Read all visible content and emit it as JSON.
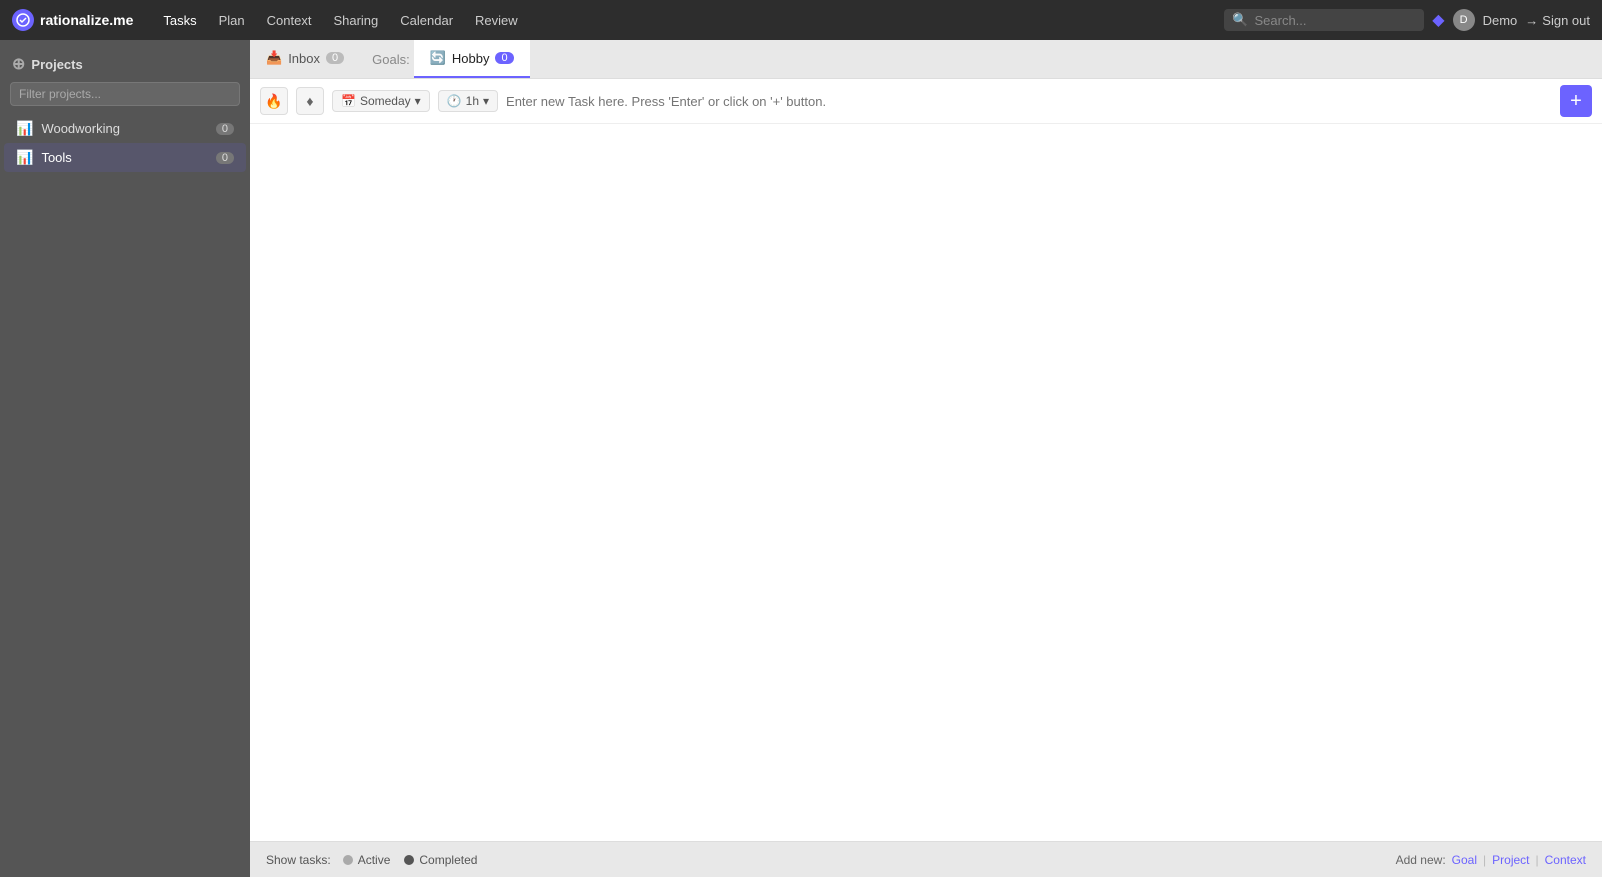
{
  "app": {
    "logo_text": "rationalize.me",
    "nav_items": [
      "Tasks",
      "Plan",
      "Context",
      "Sharing",
      "Calendar",
      "Review"
    ],
    "search_placeholder": "Search...",
    "user_name": "Demo",
    "sign_out_label": "Sign out"
  },
  "sidebar": {
    "header": "Projects",
    "filter_placeholder": "Filter projects...",
    "items": [
      {
        "label": "Woodworking",
        "count": "0"
      },
      {
        "label": "Tools",
        "count": "0"
      }
    ]
  },
  "tabs": [
    {
      "id": "inbox",
      "icon": "inbox",
      "label": "Inbox",
      "count": "0",
      "active": false
    },
    {
      "id": "goals",
      "label": "Goals:",
      "count": null,
      "active": false,
      "is_goals": true
    },
    {
      "id": "hobby",
      "icon": "hobby",
      "label": "Hobby",
      "count": "0",
      "active": true
    }
  ],
  "task_input": {
    "someday_label": "Someday",
    "time_label": "1h",
    "placeholder": "Enter new Task here. Press 'Enter' or click on '+' button.",
    "add_button": "+"
  },
  "bottom_bar": {
    "show_tasks_label": "Show tasks:",
    "active_label": "Active",
    "completed_label": "Completed",
    "add_new_label": "Add new:",
    "goal_link": "Goal",
    "project_link": "Project",
    "context_link": "Context"
  }
}
